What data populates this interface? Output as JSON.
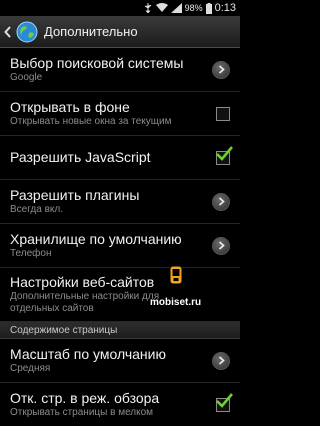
{
  "status_bar": {
    "battery": "98%",
    "time": "0:13"
  },
  "header": {
    "title": "Дополнительно"
  },
  "settings": [
    {
      "title": "Выбор поисковой системы",
      "summary": "Google",
      "control": "chevron"
    },
    {
      "title": "Открывать в фоне",
      "summary": "Открывать новые окна за текущим",
      "control": "checkbox",
      "checked": false
    },
    {
      "title": "Разрешить JavaScript",
      "summary": "",
      "control": "checkbox",
      "checked": true
    },
    {
      "title": "Разрешить плагины",
      "summary": "Всегда вкл.",
      "control": "chevron"
    },
    {
      "title": "Хранилище по умолчанию",
      "summary": "Телефон",
      "control": "chevron"
    },
    {
      "title": "Настройки веб-сайтов",
      "summary": "Дополнительные настройки для отдельных сайтов",
      "summary_line1": "Дополнительные настройки для",
      "summary_line2": "отдельных сайтов",
      "control": "none"
    }
  ],
  "section": {
    "label": "Содержимое страницы"
  },
  "page_settings": [
    {
      "title": "Масштаб по умолчанию",
      "summary": "Средняя",
      "control": "chevron"
    },
    {
      "title": "Отк. стр. в реж. обзора",
      "summary": "Открывать страницы в мелком",
      "control": "checkbox",
      "checked": true
    }
  ],
  "watermark": {
    "text": "mobiset.ru"
  },
  "colors": {
    "accent_check": "#6fd12b",
    "background": "#000000"
  }
}
